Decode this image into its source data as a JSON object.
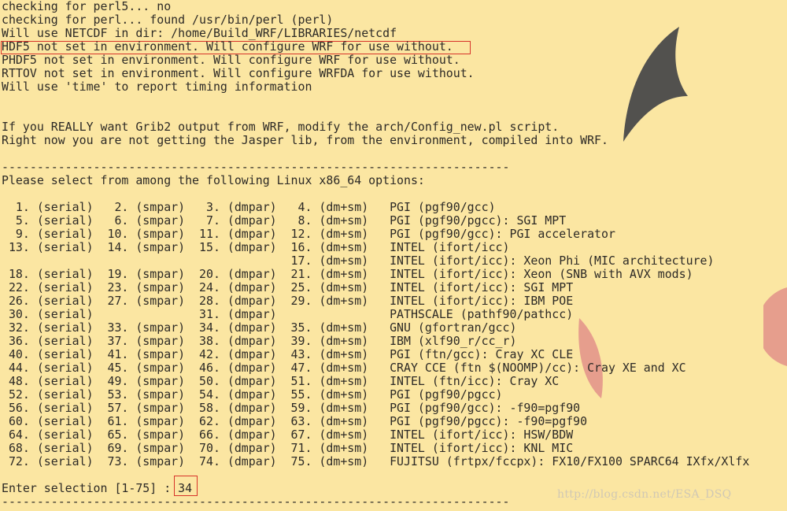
{
  "terminal": {
    "lines": [
      "checking for perl5... no",
      "checking for perl... found /usr/bin/perl (perl)",
      "Will use NETCDF in dir: /home/Build_WRF/LIBRARIES/netcdf",
      "HDF5 not set in environment. Will configure WRF for use without.",
      "PHDF5 not set in environment. Will configure WRF for use without.",
      "RTTOV not set in environment. Will configure WRFDA for use without.",
      "Will use 'time' to report timing information",
      "",
      "",
      "If you REALLY want Grib2 output from WRF, modify the arch/Config_new.pl script.",
      "Right now you are not getting the Jasper lib, from the environment, compiled into WRF.",
      "",
      "------------------------------------------------------------------------",
      "Please select from among the following Linux x86_64 options:",
      "",
      "  1. (serial)   2. (smpar)   3. (dmpar)   4. (dm+sm)   PGI (pgf90/gcc)",
      "  5. (serial)   6. (smpar)   7. (dmpar)   8. (dm+sm)   PGI (pgf90/pgcc): SGI MPT",
      "  9. (serial)  10. (smpar)  11. (dmpar)  12. (dm+sm)   PGI (pgf90/gcc): PGI accelerator",
      " 13. (serial)  14. (smpar)  15. (dmpar)  16. (dm+sm)   INTEL (ifort/icc)",
      "                                         17. (dm+sm)   INTEL (ifort/icc): Xeon Phi (MIC architecture)",
      " 18. (serial)  19. (smpar)  20. (dmpar)  21. (dm+sm)   INTEL (ifort/icc): Xeon (SNB with AVX mods)",
      " 22. (serial)  23. (smpar)  24. (dmpar)  25. (dm+sm)   INTEL (ifort/icc): SGI MPT",
      " 26. (serial)  27. (smpar)  28. (dmpar)  29. (dm+sm)   INTEL (ifort/icc): IBM POE",
      " 30. (serial)               31. (dmpar)                PATHSCALE (pathf90/pathcc)",
      " 32. (serial)  33. (smpar)  34. (dmpar)  35. (dm+sm)   GNU (gfortran/gcc)",
      " 36. (serial)  37. (smpar)  38. (dmpar)  39. (dm+sm)   IBM (xlf90_r/cc_r)",
      " 40. (serial)  41. (smpar)  42. (dmpar)  43. (dm+sm)   PGI (ftn/gcc): Cray XC CLE",
      " 44. (serial)  45. (smpar)  46. (dmpar)  47. (dm+sm)   CRAY CCE (ftn $(NOOMP)/cc): Cray XE and XC",
      " 48. (serial)  49. (smpar)  50. (dmpar)  51. (dm+sm)   INTEL (ftn/icc): Cray XC",
      " 52. (serial)  53. (smpar)  54. (dmpar)  55. (dm+sm)   PGI (pgf90/pgcc)",
      " 56. (serial)  57. (smpar)  58. (dmpar)  59. (dm+sm)   PGI (pgf90/gcc): -f90=pgf90",
      " 60. (serial)  61. (smpar)  62. (dmpar)  63. (dm+sm)   PGI (pgf90/pgcc): -f90=pgf90",
      " 64. (serial)  65. (smpar)  66. (dmpar)  67. (dm+sm)   INTEL (ifort/icc): HSW/BDW",
      " 68. (serial)  69. (smpar)  70. (dmpar)  71. (dm+sm)   INTEL (ifort/icc): KNL MIC",
      " 72. (serial)  73. (smpar)  74. (dmpar)  75. (dm+sm)   FUJITSU (frtpx/fccpx): FX10/FX100 SPARC64 IXfx/Xlfx",
      "",
      "Enter selection [1-75] : 34",
      "------------------------------------------------------------------------"
    ]
  },
  "watermark": "http://blog.csdn.net/ESA_DSQ",
  "colors": {
    "background": "#fbe6a2",
    "text": "#2d2a26",
    "highlight_box": "#d7332a",
    "dark_shape": "#4a4a4a",
    "pink_shape": "#e59b8c"
  }
}
